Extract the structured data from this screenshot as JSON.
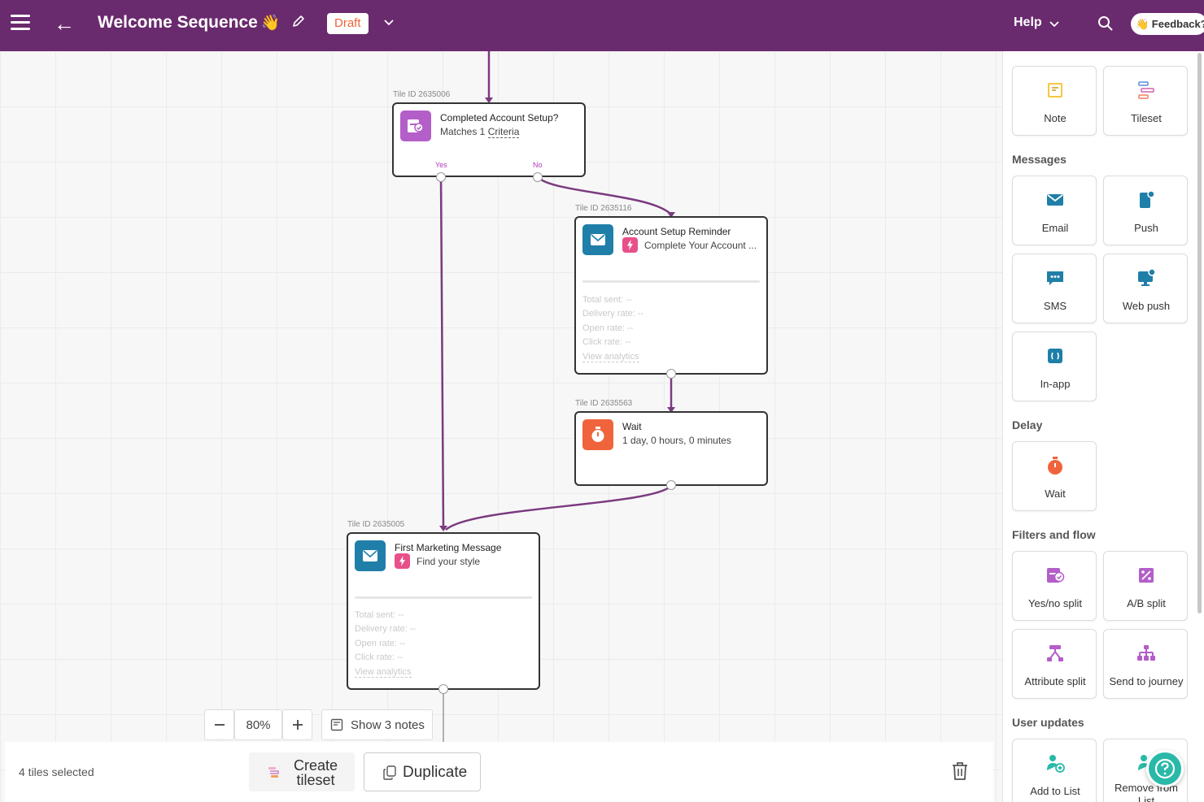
{
  "header": {
    "title": "Welcome Sequence",
    "title_emoji": "👋",
    "status": "Draft",
    "help_label": "Help",
    "feedback_label": "👋 Feedback?"
  },
  "canvas": {
    "tiles": [
      {
        "tile_id": "Tile ID 2635006",
        "title": "Completed Account Setup?",
        "subtitle_prefix": "Matches 1",
        "subtitle_link": "Criteria",
        "branch_yes": "Yes",
        "branch_no": "No"
      },
      {
        "tile_id": "Tile ID 2635116",
        "title": "Account Setup Reminder",
        "subtitle": "Complete Your Account ...",
        "stats": [
          "Total sent:  --",
          "Delivery rate:  --",
          "Open rate:  --",
          "Click rate:  --"
        ],
        "analytics_link": "View analytics"
      },
      {
        "tile_id": "Tile ID 2635563",
        "title": "Wait",
        "subtitle": "1 day, 0 hours, 0 minutes"
      },
      {
        "tile_id": "Tile ID 2635005",
        "title": "First Marketing Message",
        "subtitle": "Find your style",
        "stats": [
          "Total sent:  --",
          "Delivery rate:  --",
          "Open rate:  --",
          "Click rate:  --"
        ],
        "analytics_link": "View analytics"
      }
    ],
    "zoom_level": "80%",
    "show_notes_label": "Show 3 notes"
  },
  "selection_bar": {
    "selected_count": "4 tiles selected",
    "create_tileset_label": "Create tileset",
    "duplicate_label": "Duplicate"
  },
  "palette": {
    "top_items": [
      {
        "label": "Note",
        "icon": "note-icon"
      },
      {
        "label": "Tileset",
        "icon": "tileset-icon"
      }
    ],
    "sections": [
      {
        "title": "Messages",
        "items": [
          {
            "label": "Email",
            "icon": "email-icon"
          },
          {
            "label": "Push",
            "icon": "push-icon"
          },
          {
            "label": "SMS",
            "icon": "sms-icon"
          },
          {
            "label": "Web push",
            "icon": "web-push-icon"
          },
          {
            "label": "In-app",
            "icon": "in-app-icon"
          }
        ]
      },
      {
        "title": "Delay",
        "items": [
          {
            "label": "Wait",
            "icon": "timer-icon"
          }
        ]
      },
      {
        "title": "Filters and flow",
        "items": [
          {
            "label": "Yes/no split",
            "icon": "yes-no-split-icon"
          },
          {
            "label": "A/B split",
            "icon": "ab-split-icon"
          },
          {
            "label": "Attribute split",
            "icon": "attribute-split-icon"
          },
          {
            "label": "Send to journey",
            "icon": "send-to-journey-icon"
          }
        ]
      },
      {
        "title": "User updates",
        "items": [
          {
            "label": "Add to List",
            "icon": "add-to-list-icon"
          },
          {
            "label": "Remove from List",
            "icon": "remove-from-list-icon"
          }
        ]
      }
    ]
  },
  "colors": {
    "header_bg": "#6a2a6e",
    "connector": "#7b3a80",
    "email_tile": "#1f7fa8",
    "wait_tile": "#f0643c",
    "split_tile": "#b35ec9",
    "draft_text": "#f0643c",
    "help_fab": "#2ab9a8"
  }
}
